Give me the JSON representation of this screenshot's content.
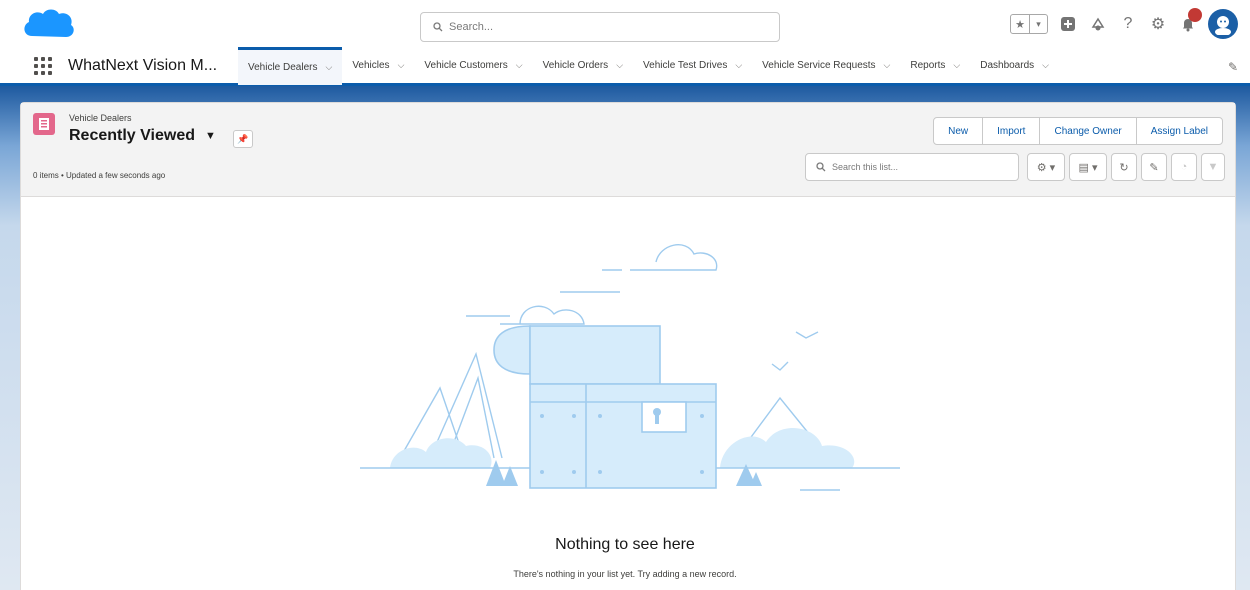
{
  "global_header": {
    "search_placeholder": "Search..."
  },
  "nav": {
    "app_name": "WhatNext Vision M...",
    "items": [
      {
        "label": "Vehicle Dealers",
        "active": true
      },
      {
        "label": "Vehicles",
        "active": false
      },
      {
        "label": "Vehicle Customers",
        "active": false
      },
      {
        "label": "Vehicle Orders",
        "active": false
      },
      {
        "label": "Vehicle Test Drives",
        "active": false
      },
      {
        "label": "Vehicle Service Requests",
        "active": false
      },
      {
        "label": "Reports",
        "active": false
      },
      {
        "label": "Dashboards",
        "active": false
      }
    ]
  },
  "list_view": {
    "object_label": "Vehicle Dealers",
    "title": "Recently Viewed",
    "meta": "0 items • Updated a few seconds ago",
    "buttons": {
      "new": "New",
      "import": "Import",
      "change_owner": "Change Owner",
      "assign_label": "Assign Label"
    },
    "search_placeholder": "Search this list..."
  },
  "empty_state": {
    "title": "Nothing to see here",
    "subtitle": "There's nothing in your list yet. Try adding a new record."
  },
  "colors": {
    "brand": "#0b5cab",
    "logo": "#1b96ff",
    "object_icon": "#e3678b",
    "illustration_stroke": "#9fcbee",
    "illustration_fill": "#d6ecfb",
    "notification_badge": "#c23934"
  },
  "icons": {
    "notification_count": "",
    "global": [
      "favorites-star-icon",
      "add-icon",
      "guidance-center-icon",
      "help-icon",
      "setup-gear-icon",
      "notifications-bell-icon",
      "user-avatar-icon"
    ],
    "list_tools": [
      "list-settings-gear-icon",
      "display-as-table-icon",
      "refresh-icon",
      "edit-inline-pencil-icon",
      "charts-icon",
      "filter-icon"
    ]
  }
}
